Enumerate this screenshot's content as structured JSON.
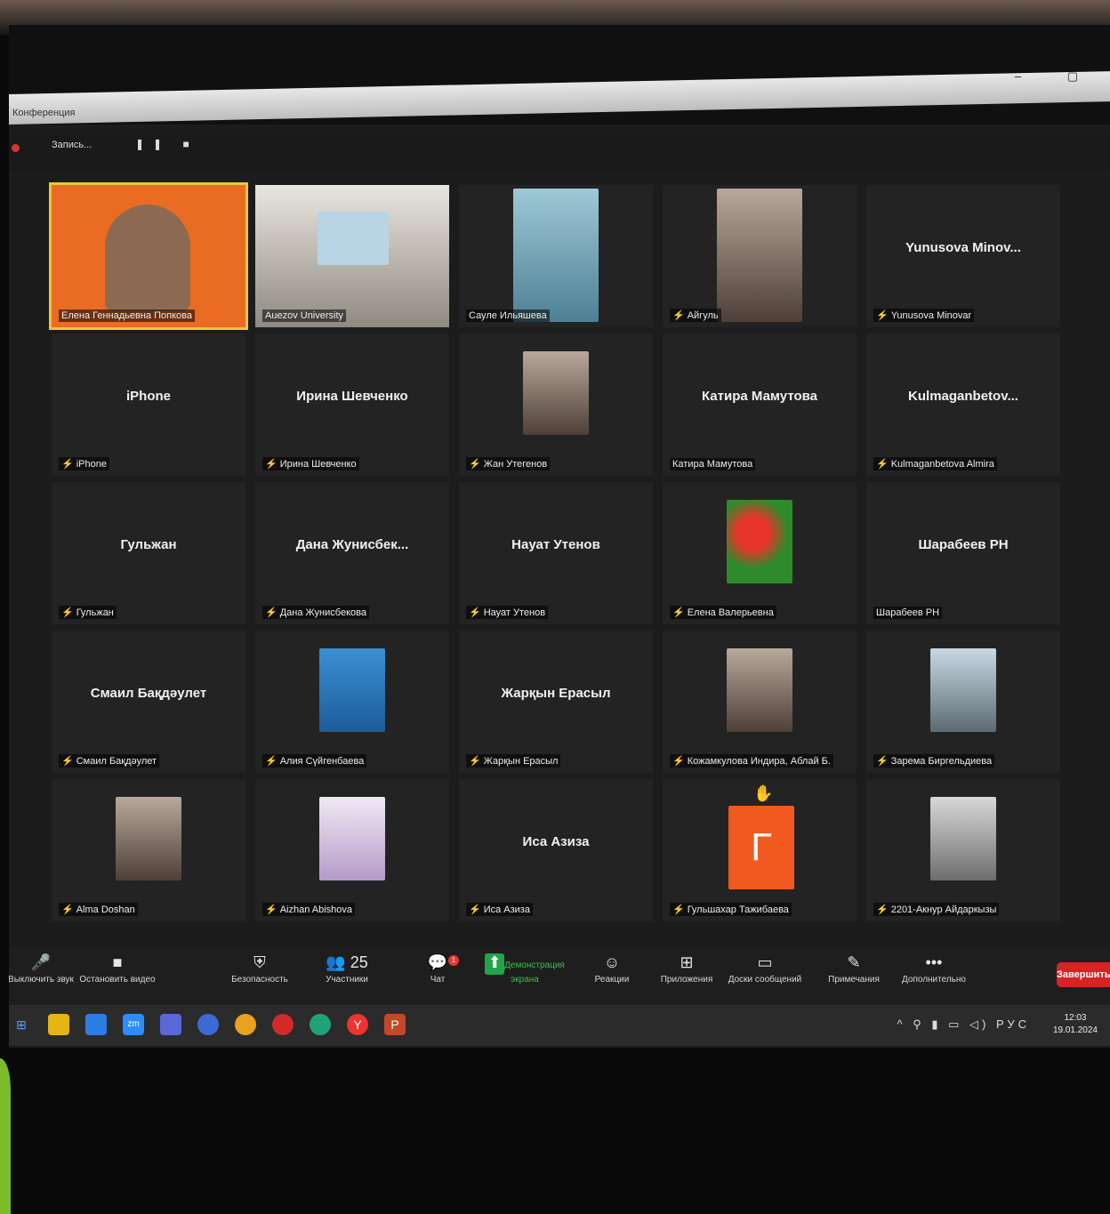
{
  "window": {
    "title": "Конференция",
    "controls": "– ▢"
  },
  "recording": {
    "label": "Запись...",
    "controls": "❚❚ ■"
  },
  "tiles": [
    {
      "name": "",
      "label": "Елена Геннадьевна Попкова",
      "muted": false,
      "thumb": "orange-photo",
      "active": true
    },
    {
      "name": "",
      "label": "Auezov University",
      "muted": false,
      "thumb": "room-photo"
    },
    {
      "name": "",
      "label": "Сауле Ильяшева",
      "muted": false,
      "thumb": "portrait-banner"
    },
    {
      "name": "",
      "label": "Айгуль",
      "muted": true,
      "thumb": "portrait"
    },
    {
      "name": "Yunusova Minov...",
      "label": "Yunusova Minovar",
      "muted": true
    },
    {
      "name": "iPhone",
      "label": "iPhone",
      "muted": true
    },
    {
      "name": "Ирина Шевченко",
      "label": "Ирина Шевченко",
      "muted": true
    },
    {
      "name": "",
      "label": "Жан Утегенов",
      "muted": true,
      "thumb": "portrait"
    },
    {
      "name": "Катира Мамутова",
      "label": "Катира Мамутова",
      "muted": false
    },
    {
      "name": "Kulmaganbetov...",
      "label": "Kulmaganbetova Almira",
      "muted": true
    },
    {
      "name": "Гульжан",
      "label": "Гульжан",
      "muted": true
    },
    {
      "name": "Дана Жунисбек...",
      "label": "Дана Жунисбекова",
      "muted": true
    },
    {
      "name": "Науат Утенов",
      "label": "Науат Утенов",
      "muted": true
    },
    {
      "name": "",
      "label": "Елена Валерьевна",
      "muted": true,
      "thumb": "flowers"
    },
    {
      "name": "Шарабеев РН",
      "label": "Шарабеев РН",
      "muted": false
    },
    {
      "name": "Смаил Бақдәулет",
      "label": "Смаил Бақдәулет",
      "muted": true
    },
    {
      "name": "",
      "label": "Алия Сүйгенбаева",
      "muted": true,
      "thumb": "portrait-blue"
    },
    {
      "name": "Жарқын Ерасыл",
      "label": "Жарқын Ерасыл",
      "muted": true
    },
    {
      "name": "",
      "label": "Кожамкулова Индира, Аблай Б.",
      "muted": true,
      "thumb": "portrait"
    },
    {
      "name": "",
      "label": "Зарема Биргельдиева",
      "muted": true,
      "thumb": "portrait-office"
    },
    {
      "name": "",
      "label": "Alma Doshan",
      "muted": true,
      "thumb": "portrait"
    },
    {
      "name": "",
      "label": "Aizhan Abishova",
      "muted": true,
      "thumb": "auezov-logo"
    },
    {
      "name": "Иса Азиза",
      "label": "Иса Азиза",
      "muted": true
    },
    {
      "name": "",
      "label": "Гульшахар Тажибаева",
      "muted": true,
      "thumb": "letter",
      "letter": "Г",
      "hand": "✋"
    },
    {
      "name": "",
      "label": "2201-Акнур Айдаркызы",
      "muted": true,
      "thumb": "cats"
    }
  ],
  "toolbar": {
    "items": [
      {
        "icon": "🎤",
        "label": "Выключить звук"
      },
      {
        "icon": "■",
        "label": "Остановить видео"
      },
      {
        "icon": "⛨",
        "label": "Безопасность"
      },
      {
        "icon": "👥 25",
        "label": "Участники"
      },
      {
        "icon": "💬",
        "label": "Чат",
        "badge": "1"
      },
      {
        "icon": "⬆",
        "label": "Демонстрация экрана",
        "green": true
      },
      {
        "icon": "☺",
        "label": "Реакции"
      },
      {
        "icon": "⊞",
        "label": "Приложения"
      },
      {
        "icon": "▭",
        "label": "Доски сообщений"
      },
      {
        "icon": "✎",
        "label": "Примечания"
      },
      {
        "icon": "•••",
        "label": "Дополнительно"
      }
    ],
    "end_label": "Завершить"
  },
  "taskbar": {
    "tray": "^ ⚲ ▮ ▭ ◁)",
    "lang": "РУС",
    "time": "12:03",
    "date": "19.01.2024"
  }
}
